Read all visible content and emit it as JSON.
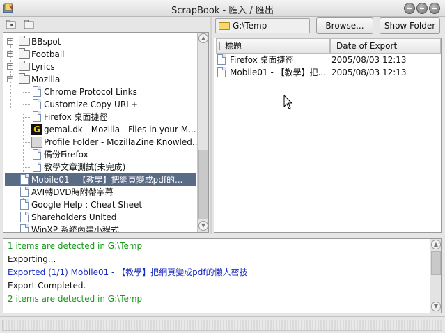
{
  "window": {
    "title": "ScrapBook - 匯入 / 匯出"
  },
  "left_toolbar": {
    "icons": [
      "new-folder-icon",
      "open-folder-icon"
    ]
  },
  "tree": {
    "items": [
      {
        "label": "BBspot",
        "type": "folder",
        "expanded": false
      },
      {
        "label": "Football",
        "type": "folder",
        "expanded": false
      },
      {
        "label": "Lyrics",
        "type": "folder",
        "expanded": false
      },
      {
        "label": "Mozilla",
        "type": "folder",
        "expanded": true
      },
      {
        "label": "Chrome Protocol Links",
        "type": "page"
      },
      {
        "label": "Customize Copy URL+",
        "type": "page"
      },
      {
        "label": "Firefox 桌面捷徑",
        "type": "page"
      },
      {
        "label": "gemal.dk - Mozilla - Files in your M...",
        "type": "page-g"
      },
      {
        "label": "Profile Folder - MozillaZine Knowled...",
        "type": "page-zine"
      },
      {
        "label": "備份Firefox",
        "type": "page"
      },
      {
        "label": "教學文章測試(未完成)",
        "type": "page"
      },
      {
        "label": "Mobile01 - 【教學】把網頁變成pdf的...",
        "type": "page",
        "selected": true
      },
      {
        "label": "AVI轉DVD時附帶字幕",
        "type": "page"
      },
      {
        "label": "Google Help : Cheat Sheet",
        "type": "page"
      },
      {
        "label": "Shareholders United",
        "type": "page"
      },
      {
        "label": "WinXP 系統內建小程式",
        "type": "page"
      }
    ]
  },
  "export": {
    "path": "G:\\Temp",
    "browse_label": "Browse...",
    "show_folder_label": "Show Folder",
    "columns": [
      "標題",
      "Date of Export"
    ],
    "rows": [
      {
        "title": "Firefox 桌面捷徑",
        "date": "2005/08/03 12:13"
      },
      {
        "title": "Mobile01 - 【教學】把...",
        "date": "2005/08/03 12:13"
      }
    ]
  },
  "log": {
    "lines": [
      {
        "text": "1 items are detected in G:\\Temp",
        "color": "#1a9a1a"
      },
      {
        "text": "Exporting...",
        "color": "#111111"
      },
      {
        "text": "Exported (1/1) Mobile01 - 【教學】把網頁變成pdf的懶人密技",
        "color": "#1a2bbf"
      },
      {
        "text": "Export Completed.",
        "color": "#111111"
      },
      {
        "text": "2 items are detected in G:\\Temp",
        "color": "#1a9a1a"
      }
    ]
  },
  "colors": {
    "selection": "#5a6b85",
    "log_green": "#1a9a1a",
    "log_blue": "#1a2bbf"
  }
}
